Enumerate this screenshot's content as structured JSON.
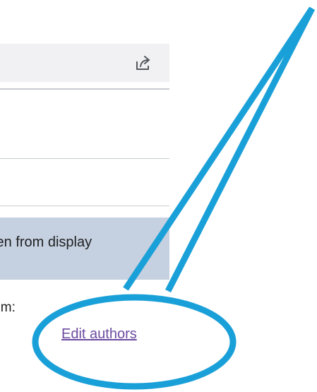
{
  "notice": {
    "text": "hidden from display"
  },
  "content": {
    "available_from": "ble from:",
    "edit_authors_link": "Edit authors"
  },
  "icons": {
    "share": "share-icon"
  },
  "colors": {
    "annotation_stroke": "#1aa0d8",
    "link": "#6b4ba1",
    "notice_bg": "#c5d0e0",
    "share_bar_bg": "#f1f1f3"
  }
}
